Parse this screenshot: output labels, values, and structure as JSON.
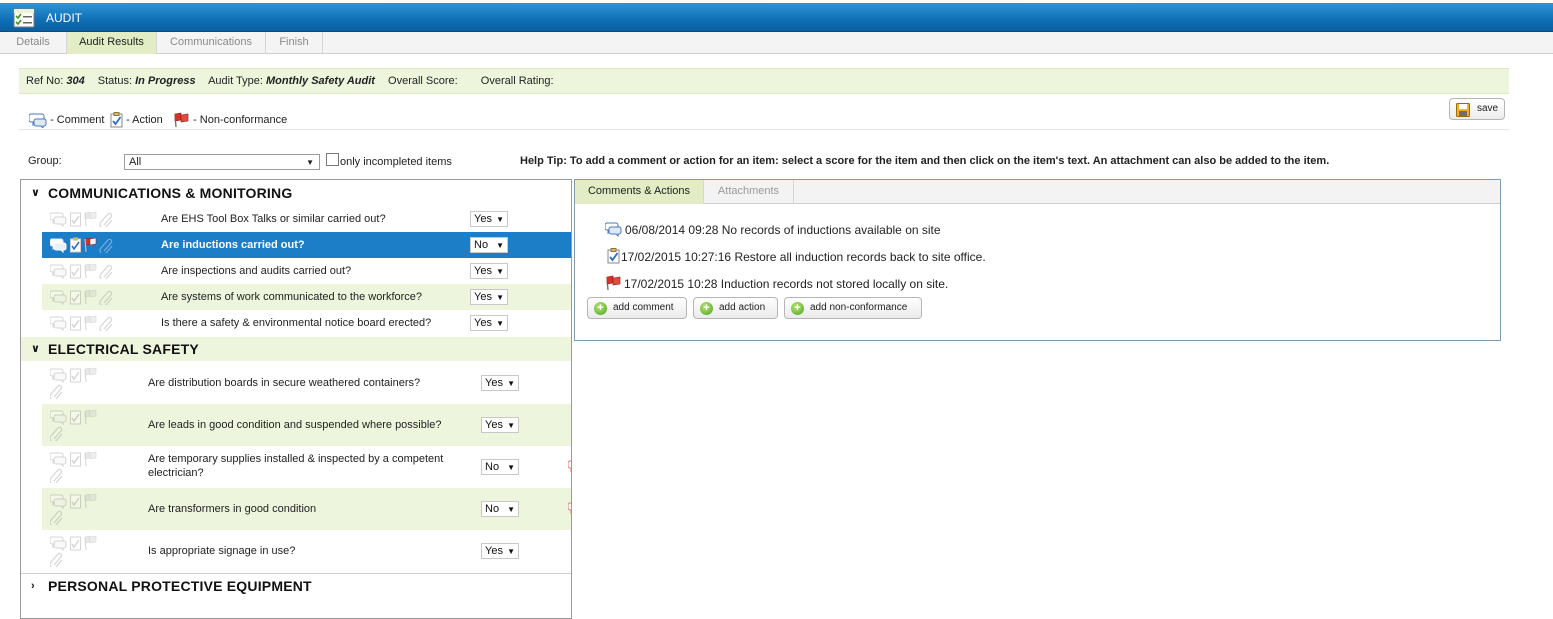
{
  "window": {
    "title": "AUDIT"
  },
  "tabs": [
    {
      "label": "Details",
      "active": false
    },
    {
      "label": "Audit Results",
      "active": true
    },
    {
      "label": "Communications",
      "active": false
    },
    {
      "label": "Finish",
      "active": false
    }
  ],
  "info": {
    "ref_label": "Ref No:",
    "ref_value": "304",
    "status_label": "Status:",
    "status_value": "In Progress",
    "type_label": "Audit Type:",
    "type_value": "Monthly Safety Audit",
    "score_label": "Overall Score:",
    "rating_label": "Overall Rating:"
  },
  "legend": {
    "comment": "- Comment",
    "action": "- Action",
    "nonconformance": "- Non-conformance"
  },
  "save_button": "save",
  "filter": {
    "group_label": "Group:",
    "group_value": "All",
    "incomplete_label": "only incompleted items",
    "help_tip_label": "Help Tip:",
    "help_tip_text": "To add a comment or action for an item: select a score for the item and then click on the item's text. An attachment can also be added to the item."
  },
  "sections": [
    {
      "title": "COMMUNICATIONS & MONITORING",
      "expanded": true,
      "items": [
        {
          "question": "Are EHS Tool Box Talks or similar carried out?",
          "score": "Yes"
        },
        {
          "question": "Are inductions carried out?",
          "score": "No",
          "selected": true
        },
        {
          "question": "Are inspections and audits carried out?",
          "score": "Yes"
        },
        {
          "question": "Are systems of work communicated to the workforce?",
          "score": "Yes"
        },
        {
          "question": "Is there a safety & environmental notice board erected?",
          "score": "Yes"
        }
      ]
    },
    {
      "title": "ELECTRICAL SAFETY",
      "expanded": true,
      "items": [
        {
          "question": "Are distribution boards in secure weathered containers?",
          "score": "Yes"
        },
        {
          "question": "Are leads in good condition and suspended where possible?",
          "score": "Yes"
        },
        {
          "question": "Are temporary supplies installed & inspected by a competent electrician?",
          "score": "No",
          "flag": true
        },
        {
          "question": "Are transformers in good condition",
          "score": "No",
          "flag": true
        },
        {
          "question": "Is appropriate signage in use?",
          "score": "Yes"
        }
      ]
    },
    {
      "title": "PERSONAL PROTECTIVE EQUIPMENT",
      "expanded": false,
      "items": []
    }
  ],
  "detail": {
    "tabs": [
      {
        "label": "Comments & Actions",
        "active": true
      },
      {
        "label": "Attachments",
        "active": false
      }
    ],
    "entries": [
      {
        "type": "comment",
        "text": "06/08/2014 09:28 No records of inductions available on site"
      },
      {
        "type": "action",
        "text": "17/02/2015 10:27:16 Restore all induction records back to site office."
      },
      {
        "type": "nonconformance",
        "text": "17/02/2015 10:28 Induction records not stored locally on site."
      }
    ],
    "buttons": {
      "add_comment": "add comment",
      "add_action": "add action",
      "add_nonconformance": "add non-conformance"
    }
  },
  "colors": {
    "title_bar": "#1b7ec6",
    "selected_row": "#1b7ec6",
    "row_alt": "#eef5dd",
    "active_tab": "#e2ecc5",
    "flag": "#d9302a"
  }
}
